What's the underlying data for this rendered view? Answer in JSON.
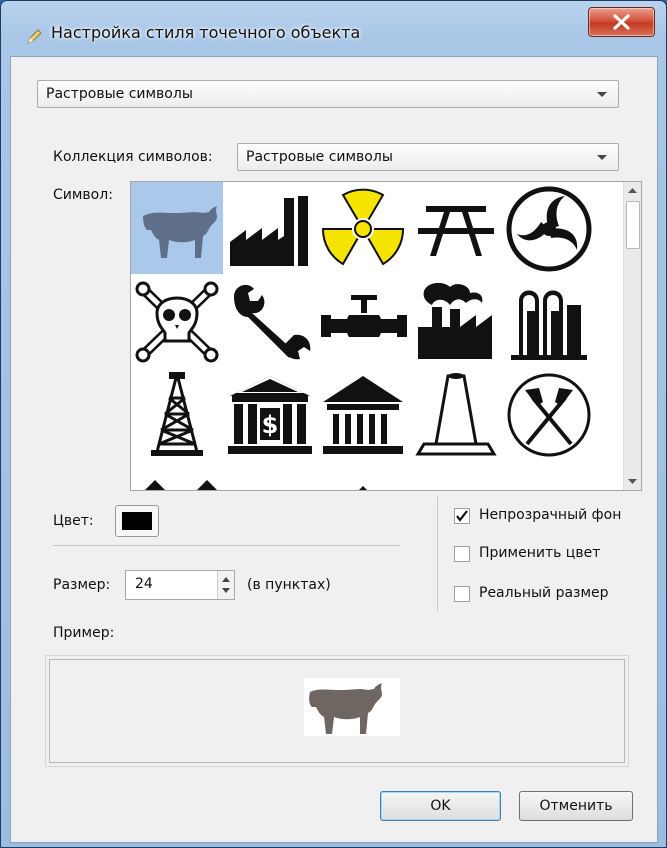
{
  "window": {
    "title": "Настройка стиля точечного объекта"
  },
  "top_combo": {
    "value": "Растровые символы"
  },
  "collection": {
    "label": "Коллекция символов:",
    "value": "Растровые символы"
  },
  "symbol_label": "Символ:",
  "symbols": [
    "bull-icon",
    "factory-icon",
    "radiation-icon",
    "picnic-table-icon",
    "triskelion-icon",
    "skull-crossbones-icon",
    "wrench-icon",
    "pipeline-valve-icon",
    "smoking-factory-icon",
    "silos-icon",
    "oil-derrick-icon",
    "bank-icon",
    "museum-icon",
    "traffic-cone-icon",
    "mine-icon"
  ],
  "selected_symbol": "bull-icon",
  "color": {
    "label": "Цвет:",
    "value": "#000000"
  },
  "size": {
    "label": "Размер:",
    "value": "24",
    "unit": "(в пунктах)"
  },
  "checkboxes": [
    {
      "label": "Непрозрачный фон",
      "checked": true
    },
    {
      "label": "Применить цвет",
      "checked": false
    },
    {
      "label": "Реальный размер",
      "checked": false
    }
  ],
  "example_label": "Пример:",
  "buttons": {
    "ok": "OK",
    "cancel": "Отменить"
  },
  "colors": {
    "selection": "#a9c8ea",
    "bull": "#5f6f8a",
    "preview_bull": "#6f6561",
    "radiation": "#f4e400"
  }
}
